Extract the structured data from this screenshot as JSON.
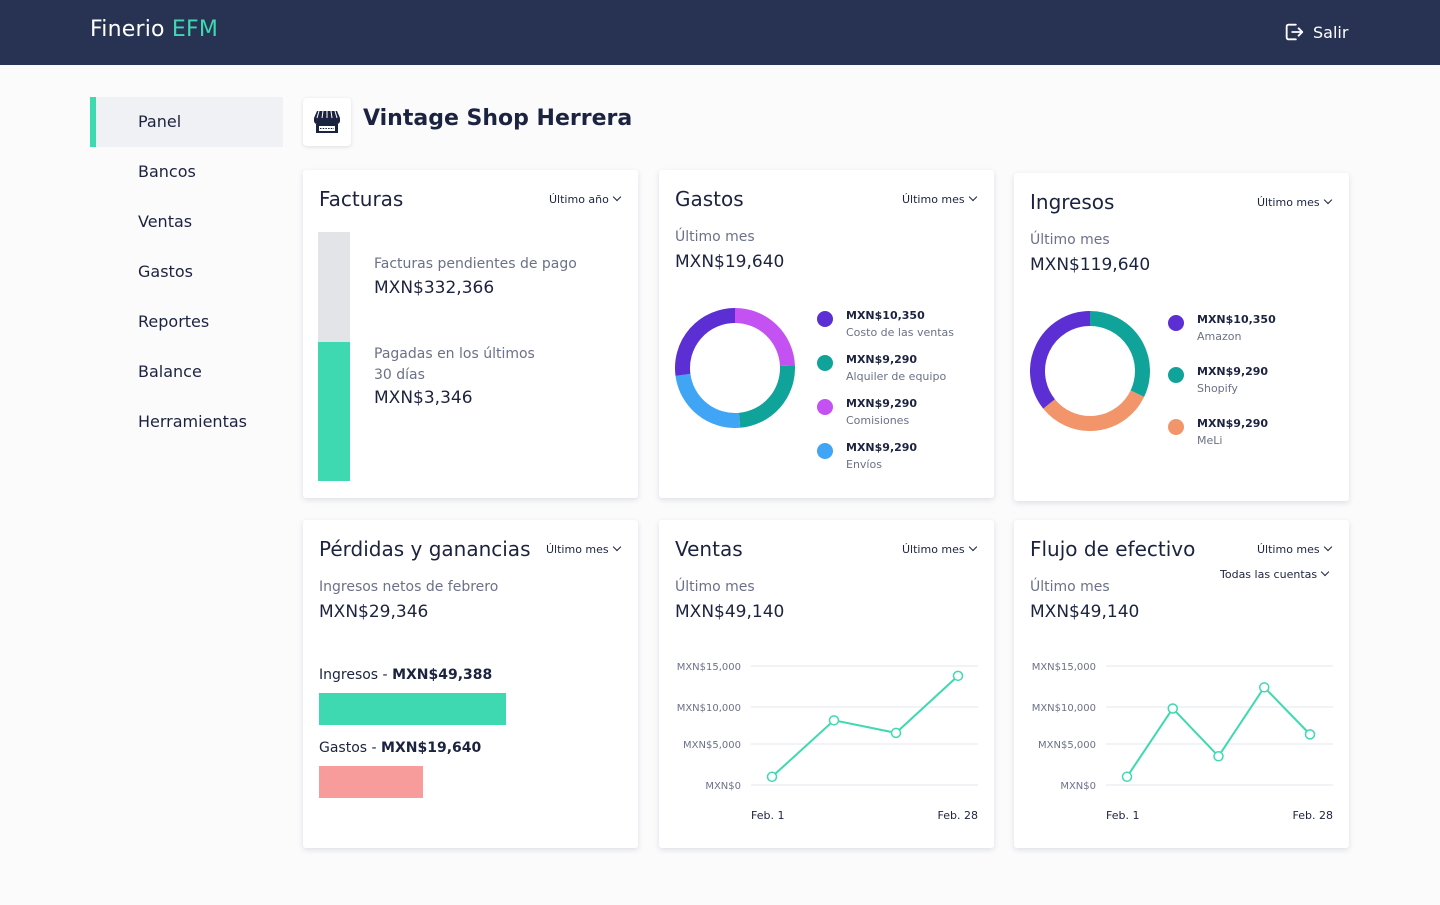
{
  "app": {
    "name": "Finerio",
    "name_accent": "EFM",
    "logout_label": "Salir"
  },
  "sidebar": {
    "items": [
      {
        "label": "Panel",
        "active": true
      },
      {
        "label": "Bancos"
      },
      {
        "label": "Ventas"
      },
      {
        "label": "Gastos"
      },
      {
        "label": "Reportes"
      },
      {
        "label": "Balance"
      },
      {
        "label": "Herramientas"
      }
    ]
  },
  "shop": {
    "name": "Vintage Shop Herrera",
    "icon": "storefront-icon"
  },
  "cards": {
    "facturas": {
      "title": "Facturas",
      "filter": "Último año",
      "pending_label": "Facturas pendientes de pago",
      "pending_value": "MXN$332,366",
      "paid_label_1": "Pagadas en los últimos",
      "paid_label_2": "30 días",
      "paid_value": "MXN$3,346",
      "paid_fraction": 0.56
    },
    "gastos": {
      "title": "Gastos",
      "filter": "Último mes",
      "period": "Último mes",
      "total": "MXN$19,640",
      "segments": [
        {
          "value": "MXN$10,350",
          "label": "Costo de las ventas",
          "amount": 10350,
          "color": "#5b2fd3"
        },
        {
          "value": "MXN$9,290",
          "label": "Alquiler de equipo",
          "amount": 9290,
          "color": "#0fa39a"
        },
        {
          "value": "MXN$9,290",
          "label": "Comisiones",
          "amount": 9290,
          "color": "#c452f2"
        },
        {
          "value": "MXN$9,290",
          "label": "Envíos",
          "amount": 9290,
          "color": "#3fa5f4"
        }
      ]
    },
    "ingresos": {
      "title": "Ingresos",
      "filter": "Último mes",
      "period": "Último mes",
      "total": "MXN$119,640",
      "segments": [
        {
          "value": "MXN$10,350",
          "label": "Amazon",
          "amount": 10350,
          "color": "#5b2fd3"
        },
        {
          "value": "MXN$9,290",
          "label": "Shopify",
          "amount": 9290,
          "color": "#0fa39a"
        },
        {
          "value": "MXN$9,290",
          "label": "MeLi",
          "amount": 9290,
          "color": "#f2956a"
        }
      ]
    },
    "pyg": {
      "title": "Pérdidas y ganancias",
      "filter": "Último mes",
      "subtitle": "Ingresos netos de febrero",
      "net": "MXN$29,346",
      "income_label": "Ingresos - ",
      "income_value": "MXN$49,388",
      "income_amount": 49388,
      "expense_label": "Gastos - ",
      "expense_value": "MXN$19,640",
      "expense_amount": 19640
    },
    "ventas": {
      "title": "Ventas",
      "filter": "Último mes",
      "period": "Último mes",
      "total": "MXN$49,140"
    },
    "flujo": {
      "title": "Flujo de efectivo",
      "filter": "Último mes",
      "account_filter": "Todas las cuentas",
      "period": "Último mes",
      "total": "MXN$49,140"
    }
  },
  "colors": {
    "accent": "#3ed9b0",
    "topbar": "#283253",
    "expense_bar": "#f79b9b",
    "pending_bar": "#e3e4e8"
  },
  "chart_data": [
    {
      "type": "line",
      "title": "Ventas",
      "x": [
        "Feb. 1",
        "",
        "",
        "",
        "Feb. 28"
      ],
      "series": [
        {
          "values": [
            1000,
            8200,
            6500,
            13800
          ]
        }
      ],
      "x_tick_labels": [
        "Feb. 1",
        "Feb. 28"
      ],
      "y_tick_labels": [
        "MXN$0",
        "MXN$5,000",
        "MXN$10,000",
        "MXN$15,000"
      ],
      "ylim": [
        0,
        15000
      ],
      "grid": true,
      "color": "#3ed9b0"
    },
    {
      "type": "line",
      "title": "Flujo de efectivo",
      "x": [
        "Feb. 1",
        "",
        "",
        "",
        "",
        "Feb. 28"
      ],
      "series": [
        {
          "values": [
            1000,
            9800,
            3500,
            12400,
            6300
          ]
        }
      ],
      "x_tick_labels": [
        "Feb. 1",
        "Feb. 28"
      ],
      "y_tick_labels": [
        "MXN$0",
        "MXN$5,000",
        "MXN$10,000",
        "MXN$15,000"
      ],
      "ylim": [
        0,
        15000
      ],
      "grid": true,
      "color": "#3ed9b0"
    }
  ]
}
